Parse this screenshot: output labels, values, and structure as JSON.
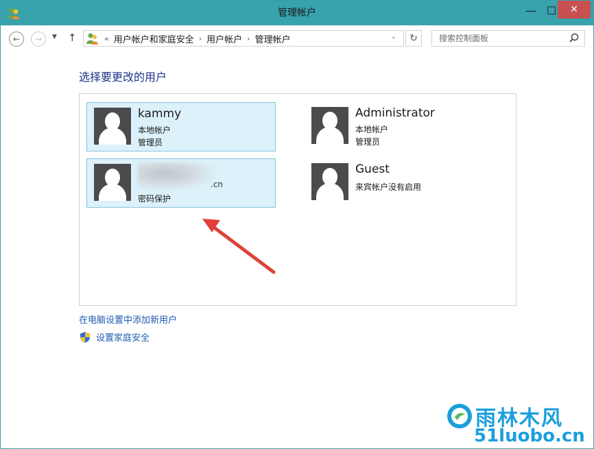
{
  "window": {
    "title": "管理帐户"
  },
  "titlebar_buttons": {
    "minimize": "—",
    "maximize": "☐",
    "close": "✕"
  },
  "navigation": {
    "back_icon": "arrow-left-icon",
    "forward_icon": "arrow-right-icon",
    "recent_icon": "chevron-down-icon",
    "up_icon": "arrow-up-icon",
    "overflow": "«",
    "breadcrumbs": [
      "用户帐户和家庭安全",
      "用户帐户",
      "管理帐户"
    ],
    "separator": "›",
    "refresh_icon": "refresh-icon"
  },
  "search": {
    "placeholder": "搜索控制面板"
  },
  "main": {
    "heading": "选择要更改的用户",
    "users": [
      {
        "name": "kammy",
        "line1": "本地帐户",
        "line2": "管理员",
        "selected": true
      },
      {
        "name": "Administrator",
        "line1": "本地帐户",
        "line2": "管理员",
        "selected": false
      },
      {
        "name": "",
        "line1_suffix": ".cn",
        "line2": "密码保护",
        "selected": true
      },
      {
        "name": "Guest",
        "line1": "来宾帐户没有启用",
        "line2": "",
        "selected": false
      }
    ],
    "links": {
      "add_user": "在电脑设置中添加新用户",
      "family_safety": "设置家庭安全"
    }
  },
  "watermark": {
    "cn": "雨林木风",
    "en": "51luobo.cn"
  },
  "colors": {
    "titlebar": "#38a2ad",
    "close_button": "#c75050",
    "heading": "#1e3287",
    "link": "#1e5bb3",
    "tile_selected_bg": "#dcf1f9",
    "tile_selected_border": "#85c5dd",
    "avatar_bg": "#4b4b4b",
    "arrow": "#e0403a",
    "watermark": "#1b9fdc"
  }
}
